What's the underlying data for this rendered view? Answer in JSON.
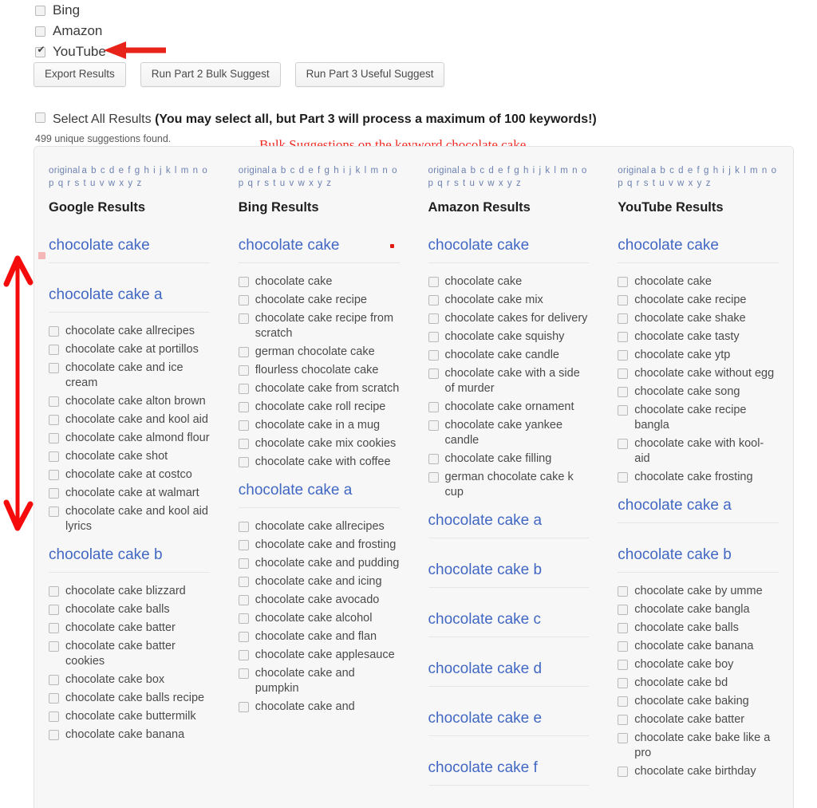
{
  "engines": [
    {
      "label": "Bing",
      "checked": false
    },
    {
      "label": "Amazon",
      "checked": false
    },
    {
      "label": "YouTube",
      "checked": true
    }
  ],
  "buttons": {
    "export": "Export Results",
    "part2": "Run Part 2 Bulk Suggest",
    "part3": "Run Part 3 Useful Suggest"
  },
  "select_all": {
    "label": "Select All Results ",
    "note": "(You may select all, but Part 3 will process a maximum of 100 keywords!)"
  },
  "found_count": "499 unique suggestions found.",
  "annotation": "Bulk Suggestions on the keyword chocolate cake",
  "alphabet": {
    "original": "original",
    "letters": "a b c d e f g h i j k l m n o p q r s t u v w x y z"
  },
  "colors": {
    "link_blue": "#4268c4",
    "alpha_blue": "#6d81b0",
    "annotation_red": "#ef2a22",
    "panel_bg": "#f7f7f7"
  },
  "columns": [
    {
      "title": "Google Results",
      "groups": [
        {
          "head": "chocolate cake",
          "items": []
        },
        {
          "head": "chocolate cake a",
          "items": [
            "chocolate cake allrecipes",
            "chocolate cake at portillos",
            "chocolate cake and ice cream",
            "chocolate cake alton brown",
            "chocolate cake and kool aid",
            "chocolate cake almond flour",
            "chocolate cake shot",
            "chocolate cake at costco",
            "chocolate cake at walmart",
            "chocolate cake and kool aid lyrics"
          ]
        },
        {
          "head": "chocolate cake b",
          "items": [
            "chocolate cake blizzard",
            "chocolate cake balls",
            "chocolate cake batter",
            "chocolate cake batter cookies",
            "chocolate cake box",
            "chocolate cake balls recipe",
            "chocolate cake buttermilk",
            "chocolate cake banana"
          ]
        }
      ]
    },
    {
      "title": "Bing Results",
      "groups": [
        {
          "head": "chocolate cake",
          "items": [
            "chocolate cake",
            "chocolate cake recipe",
            "chocolate cake recipe from scratch",
            "german chocolate cake",
            "flourless chocolate cake",
            "chocolate cake from scratch",
            "chocolate cake roll recipe",
            "chocolate cake in a mug",
            "chocolate cake mix cookies",
            "chocolate cake with coffee"
          ]
        },
        {
          "head": "chocolate cake a",
          "items": [
            "chocolate cake allrecipes",
            "chocolate cake and frosting",
            "chocolate cake and pudding",
            "chocolate cake and icing",
            "chocolate cake avocado",
            "chocolate cake alcohol",
            "chocolate cake and flan",
            "chocolate cake applesauce",
            "chocolate cake and pumpkin",
            "chocolate cake and"
          ]
        }
      ]
    },
    {
      "title": "Amazon Results",
      "groups": [
        {
          "head": "chocolate cake",
          "items": [
            "chocolate cake",
            "chocolate cake mix",
            "chocolate cakes for delivery",
            "chocolate cake squishy",
            "chocolate cake candle",
            "chocolate cake with a side of murder",
            "chocolate cake ornament",
            "chocolate cake yankee candle",
            "chocolate cake filling",
            "german chocolate cake k cup"
          ]
        },
        {
          "head": "chocolate cake a",
          "items": []
        },
        {
          "head": "chocolate cake b",
          "items": []
        },
        {
          "head": "chocolate cake c",
          "items": []
        },
        {
          "head": "chocolate cake d",
          "items": []
        },
        {
          "head": "chocolate cake e",
          "items": []
        },
        {
          "head": "chocolate cake f",
          "items": []
        }
      ]
    },
    {
      "title": "YouTube Results",
      "groups": [
        {
          "head": "chocolate cake",
          "items": [
            "chocolate cake",
            "chocolate cake recipe",
            "chocolate cake shake",
            "chocolate cake tasty",
            "chocolate cake ytp",
            "chocolate cake without egg",
            "chocolate cake song",
            "chocolate cake recipe bangla",
            "chocolate cake with kool-aid",
            "chocolate cake frosting"
          ]
        },
        {
          "head": "chocolate cake a",
          "items": []
        },
        {
          "head": "chocolate cake b",
          "items": [
            "chocolate cake by umme",
            "chocolate cake bangla",
            "chocolate cake balls",
            "chocolate cake banana",
            "chocolate cake boy",
            "chocolate cake bd",
            "chocolate cake baking",
            "chocolate cake batter",
            "chocolate cake bake like a pro",
            "chocolate cake birthday"
          ]
        }
      ]
    }
  ]
}
